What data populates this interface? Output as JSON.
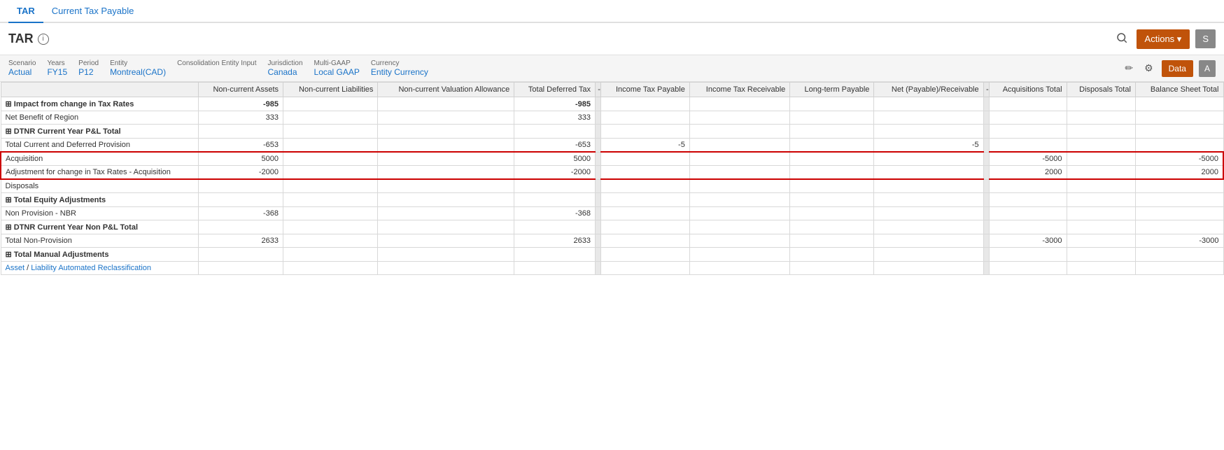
{
  "tabs": [
    {
      "id": "tar",
      "label": "TAR",
      "active": true
    },
    {
      "id": "current-tax-payable",
      "label": "Current Tax Payable",
      "active": false
    }
  ],
  "page": {
    "title": "TAR",
    "info_tooltip": "i"
  },
  "header_buttons": {
    "search_icon": "🔍",
    "actions_label": "Actions ▾",
    "s_label": "S"
  },
  "filters": [
    {
      "label": "Scenario",
      "value": "Actual"
    },
    {
      "label": "Years",
      "value": "FY15"
    },
    {
      "label": "Period",
      "value": "P12"
    },
    {
      "label": "Entity",
      "value": "Montreal(CAD)"
    },
    {
      "label": "Consolidation Entity Input",
      "value": ""
    },
    {
      "label": "Jurisdiction",
      "value": "Canada"
    },
    {
      "label": "Multi-GAAP",
      "value": "Local GAAP"
    },
    {
      "label": "Currency",
      "value": "Entity Currency"
    }
  ],
  "toolbar": {
    "edit_icon": "✏",
    "gear_icon": "⚙",
    "data_label": "Data",
    "a_label": "A"
  },
  "table": {
    "columns": [
      {
        "id": "row-label",
        "label": ""
      },
      {
        "id": "non-current-assets",
        "label": "Non-current Assets"
      },
      {
        "id": "non-current-liabilities",
        "label": "Non-current Liabilities"
      },
      {
        "id": "non-current-valuation-allowance",
        "label": "Non-current Valuation Allowance"
      },
      {
        "id": "total-deferred-tax",
        "label": "Total Deferred Tax"
      },
      {
        "id": "sep1",
        "label": "-",
        "separator": true
      },
      {
        "id": "income-tax-payable",
        "label": "Income Tax Payable"
      },
      {
        "id": "income-tax-receivable",
        "label": "Income Tax Receivable"
      },
      {
        "id": "long-term-payable",
        "label": "Long-term Payable"
      },
      {
        "id": "net-payable-receivable",
        "label": "Net (Payable)/Receivable"
      },
      {
        "id": "sep2",
        "label": "-",
        "separator": true
      },
      {
        "id": "acquisitions-total",
        "label": "Acquisitions Total"
      },
      {
        "id": "disposals-total",
        "label": "Disposals Total"
      },
      {
        "id": "balance-sheet-total",
        "label": "Balance Sheet Total"
      }
    ],
    "rows": [
      {
        "id": "impact-tax-rates",
        "label": "⊞ Impact from change in Tax Rates",
        "bold": true,
        "expandable": true,
        "values": {
          "non-current-assets": "-985",
          "non-current-liabilities": "",
          "non-current-valuation-allowance": "",
          "total-deferred-tax": "-985",
          "income-tax-payable": "",
          "income-tax-receivable": "",
          "long-term-payable": "",
          "net-payable-receivable": "",
          "acquisitions-total": "",
          "disposals-total": "",
          "balance-sheet-total": ""
        }
      },
      {
        "id": "net-benefit-region",
        "label": "Net Benefit of Region",
        "bold": false,
        "expandable": false,
        "values": {
          "non-current-assets": "333",
          "non-current-liabilities": "",
          "non-current-valuation-allowance": "",
          "total-deferred-tax": "333",
          "income-tax-payable": "",
          "income-tax-receivable": "",
          "long-term-payable": "",
          "net-payable-receivable": "",
          "acquisitions-total": "",
          "disposals-total": "",
          "balance-sheet-total": ""
        }
      },
      {
        "id": "dtnr-current-year-pl-total",
        "label": "⊞ DTNR Current Year P&L Total",
        "bold": true,
        "expandable": true,
        "values": {
          "non-current-assets": "",
          "non-current-liabilities": "",
          "non-current-valuation-allowance": "",
          "total-deferred-tax": "",
          "income-tax-payable": "",
          "income-tax-receivable": "",
          "long-term-payable": "",
          "net-payable-receivable": "",
          "acquisitions-total": "",
          "disposals-total": "",
          "balance-sheet-total": ""
        }
      },
      {
        "id": "total-current-deferred-provision",
        "label": "Total Current and Deferred Provision",
        "bold": false,
        "expandable": false,
        "values": {
          "non-current-assets": "-653",
          "non-current-liabilities": "",
          "non-current-valuation-allowance": "",
          "total-deferred-tax": "-653",
          "income-tax-payable": "-5",
          "income-tax-receivable": "",
          "long-term-payable": "",
          "net-payable-receivable": "-5",
          "acquisitions-total": "",
          "disposals-total": "",
          "balance-sheet-total": ""
        }
      },
      {
        "id": "acquisition",
        "label": "Acquisition",
        "bold": false,
        "expandable": false,
        "highlight": true,
        "highlightPos": "first",
        "values": {
          "non-current-assets": "5000",
          "non-current-liabilities": "",
          "non-current-valuation-allowance": "",
          "total-deferred-tax": "5000",
          "income-tax-payable": "",
          "income-tax-receivable": "",
          "long-term-payable": "",
          "net-payable-receivable": "",
          "acquisitions-total": "-5000",
          "disposals-total": "",
          "balance-sheet-total": "-5000"
        }
      },
      {
        "id": "adjustment-tax-rates-acquisition",
        "label": "Adjustment for change in Tax Rates - Acquisition",
        "bold": false,
        "expandable": false,
        "highlight": true,
        "highlightPos": "last",
        "values": {
          "non-current-assets": "-2000",
          "non-current-liabilities": "",
          "non-current-valuation-allowance": "",
          "total-deferred-tax": "-2000",
          "income-tax-payable": "",
          "income-tax-receivable": "",
          "long-term-payable": "",
          "net-payable-receivable": "",
          "acquisitions-total": "2000",
          "disposals-total": "",
          "balance-sheet-total": "2000"
        }
      },
      {
        "id": "disposals",
        "label": "Disposals",
        "bold": false,
        "expandable": false,
        "values": {
          "non-current-assets": "",
          "non-current-liabilities": "",
          "non-current-valuation-allowance": "",
          "total-deferred-tax": "",
          "income-tax-payable": "",
          "income-tax-receivable": "",
          "long-term-payable": "",
          "net-payable-receivable": "",
          "acquisitions-total": "",
          "disposals-total": "",
          "balance-sheet-total": ""
        }
      },
      {
        "id": "total-equity-adjustments",
        "label": "⊞ Total Equity Adjustments",
        "bold": true,
        "expandable": true,
        "values": {
          "non-current-assets": "",
          "non-current-liabilities": "",
          "non-current-valuation-allowance": "",
          "total-deferred-tax": "",
          "income-tax-payable": "",
          "income-tax-receivable": "",
          "long-term-payable": "",
          "net-payable-receivable": "",
          "acquisitions-total": "",
          "disposals-total": "",
          "balance-sheet-total": ""
        }
      },
      {
        "id": "non-provision-nbr",
        "label": "Non Provision - NBR",
        "bold": false,
        "expandable": false,
        "values": {
          "non-current-assets": "-368",
          "non-current-liabilities": "",
          "non-current-valuation-allowance": "",
          "total-deferred-tax": "-368",
          "income-tax-payable": "",
          "income-tax-receivable": "",
          "long-term-payable": "",
          "net-payable-receivable": "",
          "acquisitions-total": "",
          "disposals-total": "",
          "balance-sheet-total": ""
        }
      },
      {
        "id": "dtnr-current-year-non-pl-total",
        "label": "⊞ DTNR Current Year Non P&L Total",
        "bold": true,
        "expandable": true,
        "values": {
          "non-current-assets": "",
          "non-current-liabilities": "",
          "non-current-valuation-allowance": "",
          "total-deferred-tax": "",
          "income-tax-payable": "",
          "income-tax-receivable": "",
          "long-term-payable": "",
          "net-payable-receivable": "",
          "acquisitions-total": "",
          "disposals-total": "",
          "balance-sheet-total": ""
        }
      },
      {
        "id": "total-non-provision",
        "label": "Total Non-Provision",
        "bold": false,
        "expandable": false,
        "values": {
          "non-current-assets": "2633",
          "non-current-liabilities": "",
          "non-current-valuation-allowance": "",
          "total-deferred-tax": "2633",
          "income-tax-payable": "",
          "income-tax-receivable": "",
          "long-term-payable": "",
          "net-payable-receivable": "",
          "acquisitions-total": "-3000",
          "disposals-total": "",
          "balance-sheet-total": "-3000"
        }
      },
      {
        "id": "total-manual-adjustments",
        "label": "⊞ Total Manual Adjustments",
        "bold": true,
        "expandable": true,
        "values": {
          "non-current-assets": "",
          "non-current-liabilities": "",
          "non-current-valuation-allowance": "",
          "total-deferred-tax": "",
          "income-tax-payable": "",
          "income-tax-receivable": "",
          "long-term-payable": "",
          "net-payable-receivable": "",
          "acquisitions-total": "",
          "disposals-total": "",
          "balance-sheet-total": ""
        }
      },
      {
        "id": "asset-liability-reclassification",
        "label": "Asset / Liability Automated Reclassification",
        "bold": false,
        "expandable": false,
        "hasLink": true,
        "values": {
          "non-current-assets": "",
          "non-current-liabilities": "",
          "non-current-valuation-allowance": "",
          "total-deferred-tax": "",
          "income-tax-payable": "",
          "income-tax-receivable": "",
          "long-term-payable": "",
          "net-payable-receivable": "",
          "acquisitions-total": "",
          "disposals-total": "",
          "balance-sheet-total": ""
        }
      }
    ]
  }
}
